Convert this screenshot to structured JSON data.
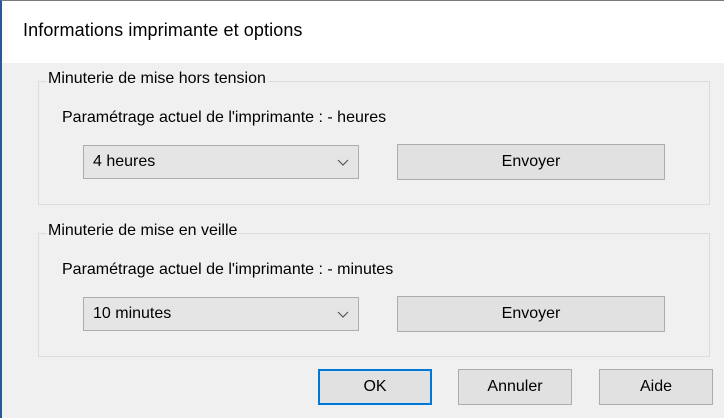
{
  "window": {
    "title": "Informations imprimante et options"
  },
  "power_off_timer": {
    "legend": "Minuterie de mise hors tension",
    "current_setting": "Paramétrage actuel de l'imprimante : - heures",
    "selected_value": "4 heures",
    "send_label": "Envoyer"
  },
  "sleep_timer": {
    "legend": "Minuterie de mise en veille",
    "current_setting": "Paramétrage actuel de l'imprimante : - minutes",
    "selected_value": "10 minutes",
    "send_label": "Envoyer"
  },
  "footer": {
    "ok_label": "OK",
    "cancel_label": "Annuler",
    "help_label": "Aide"
  },
  "icons": {
    "dropdown": "chevron-down-icon"
  },
  "colors": {
    "focus_border": "#0078d7",
    "button_face": "#e1e1e1",
    "window_background": "#f0f0f0"
  }
}
